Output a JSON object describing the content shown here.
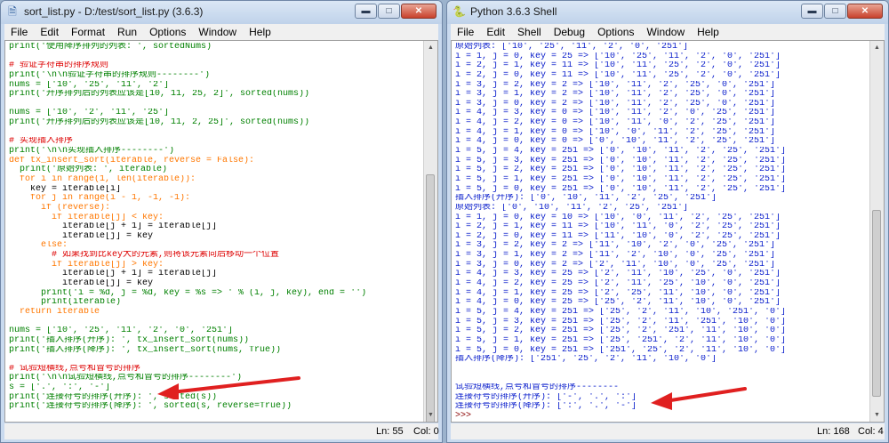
{
  "editor": {
    "title": "sort_list.py - D:/test/sort_list.py (3.6.3)",
    "menu": [
      "File",
      "Edit",
      "Format",
      "Run",
      "Options",
      "Window",
      "Help"
    ],
    "lines": [
      {
        "t": "print('使用降序排列的列表: ', sortedNums)",
        "c": "#008000"
      },
      {
        "t": "",
        "c": "#000000"
      },
      {
        "t": "# 验证字符串的排序规则",
        "c": "#dd0000"
      },
      {
        "t": "print('\\n\\n验证字符串的排序规则--------')",
        "c": "#008000"
      },
      {
        "t": "nums = ['10', '25', '11', '2']",
        "c": "#008000"
      },
      {
        "t": "print('升序排列后的列表应该是[10, 11, 25, 2]', sorted(nums))",
        "c": "#008000"
      },
      {
        "t": "",
        "c": "#000000"
      },
      {
        "t": "nums = ['10', '2', '11', '25']",
        "c": "#008000"
      },
      {
        "t": "print('升序排列后的列表应该是[10, 11, 2, 25]', sorted(nums))",
        "c": "#008000"
      },
      {
        "t": "",
        "c": "#000000"
      },
      {
        "t": "# 实现插入排序",
        "c": "#dd0000"
      },
      {
        "t": "print('\\n\\n实现插入排序--------')",
        "c": "#008000"
      },
      {
        "t": "def tx_insert_sort(iterable, reverse = False):",
        "c": "#ff7700"
      },
      {
        "t": "  print('原始列表: ', iterable)",
        "c": "#008000"
      },
      {
        "t": "  for i in range(1, len(iterable)):",
        "c": "#ff7700"
      },
      {
        "t": "    key = iterable[i]",
        "c": "#000000"
      },
      {
        "t": "    for j in range(i - 1, -1, -1):",
        "c": "#ff7700"
      },
      {
        "t": "      if (reverse):",
        "c": "#ff7700"
      },
      {
        "t": "        if iterable[j] < key:",
        "c": "#ff7700"
      },
      {
        "t": "          iterable[j + 1] = iterable[j]",
        "c": "#000000"
      },
      {
        "t": "          iterable[j] = key",
        "c": "#000000"
      },
      {
        "t": "      else:",
        "c": "#ff7700"
      },
      {
        "t": "        # 如果找到比key大的元素,则将该元素向后移动一个位置",
        "c": "#dd0000"
      },
      {
        "t": "        if iterable[j] > key:",
        "c": "#ff7700"
      },
      {
        "t": "          iterable[j + 1] = iterable[j]",
        "c": "#000000"
      },
      {
        "t": "          iterable[j] = key",
        "c": "#000000"
      },
      {
        "t": "      print('i = %d, j = %d, key = %s => ' % (i, j, key), end = '')",
        "c": "#008000"
      },
      {
        "t": "      print(iterable)",
        "c": "#008000"
      },
      {
        "t": "  return iterable",
        "c": "#ff7700"
      },
      {
        "t": "",
        "c": "#000000"
      },
      {
        "t": "nums = ['10', '25', '11', '2', '0', '251']",
        "c": "#008000"
      },
      {
        "t": "print('插入排序(升序): ', tx_insert_sort(nums))",
        "c": "#008000"
      },
      {
        "t": "print('插入排序(降序): ', tx_insert_sort(nums, True))",
        "c": "#008000"
      },
      {
        "t": "",
        "c": "#000000"
      },
      {
        "t": "# 试验短横线,点号和冒号的排序",
        "c": "#dd0000"
      },
      {
        "t": "print('\\n\\n试验短横线,点号和冒号的排序--------')",
        "c": "#008000"
      },
      {
        "t": "s = ['.', ':', '-']",
        "c": "#008000"
      },
      {
        "t": "print('连接符号的排序(升序): ', sorted(s))",
        "c": "#008000"
      },
      {
        "t": "print('连接符号的排序(降序): ', sorted(s, reverse=True))",
        "c": "#008000"
      }
    ],
    "status": {
      "ln": "Ln: 55",
      "col": "Col: 0"
    }
  },
  "shell": {
    "title": "Python 3.6.3 Shell",
    "menu": [
      "File",
      "Edit",
      "Shell",
      "Debug",
      "Options",
      "Window",
      "Help"
    ],
    "lines": [
      {
        "t": "原始列表: ['10', '25', '11', '2', '0', '251']",
        "c": "#0b1fcc"
      },
      {
        "t": "i = 1, j = 0, key = 25 => ['10', '25', '11', '2', '0', '251']",
        "c": "#0b1fcc"
      },
      {
        "t": "i = 2, j = 1, key = 11 => ['10', '11', '25', '2', '0', '251']",
        "c": "#0b1fcc"
      },
      {
        "t": "i = 2, j = 0, key = 11 => ['10', '11', '25', '2', '0', '251']",
        "c": "#0b1fcc"
      },
      {
        "t": "i = 3, j = 2, key = 2 => ['10', '11', '2', '25', '0', '251']",
        "c": "#0b1fcc"
      },
      {
        "t": "i = 3, j = 1, key = 2 => ['10', '11', '2', '25', '0', '251']",
        "c": "#0b1fcc"
      },
      {
        "t": "i = 3, j = 0, key = 2 => ['10', '11', '2', '25', '0', '251']",
        "c": "#0b1fcc"
      },
      {
        "t": "i = 4, j = 3, key = 0 => ['10', '11', '2', '0', '25', '251']",
        "c": "#0b1fcc"
      },
      {
        "t": "i = 4, j = 2, key = 0 => ['10', '11', '0', '2', '25', '251']",
        "c": "#0b1fcc"
      },
      {
        "t": "i = 4, j = 1, key = 0 => ['10', '0', '11', '2', '25', '251']",
        "c": "#0b1fcc"
      },
      {
        "t": "i = 4, j = 0, key = 0 => ['0', '10', '11', '2', '25', '251']",
        "c": "#0b1fcc"
      },
      {
        "t": "i = 5, j = 4, key = 251 => ['0', '10', '11', '2', '25', '251']",
        "c": "#0b1fcc"
      },
      {
        "t": "i = 5, j = 3, key = 251 => ['0', '10', '11', '2', '25', '251']",
        "c": "#0b1fcc"
      },
      {
        "t": "i = 5, j = 2, key = 251 => ['0', '10', '11', '2', '25', '251']",
        "c": "#0b1fcc"
      },
      {
        "t": "i = 5, j = 1, key = 251 => ['0', '10', '11', '2', '25', '251']",
        "c": "#0b1fcc"
      },
      {
        "t": "i = 5, j = 0, key = 251 => ['0', '10', '11', '2', '25', '251']",
        "c": "#0b1fcc"
      },
      {
        "t": "插入排序(升序): ['0', '10', '11', '2', '25', '251']",
        "c": "#0b1fcc"
      },
      {
        "t": "原始列表: ['0', '10', '11', '2', '25', '251']",
        "c": "#0b1fcc"
      },
      {
        "t": "i = 1, j = 0, key = 10 => ['10', '0', '11', '2', '25', '251']",
        "c": "#0b1fcc"
      },
      {
        "t": "i = 2, j = 1, key = 11 => ['10', '11', '0', '2', '25', '251']",
        "c": "#0b1fcc"
      },
      {
        "t": "i = 2, j = 0, key = 11 => ['11', '10', '0', '2', '25', '251']",
        "c": "#0b1fcc"
      },
      {
        "t": "i = 3, j = 2, key = 2 => ['11', '10', '2', '0', '25', '251']",
        "c": "#0b1fcc"
      },
      {
        "t": "i = 3, j = 1, key = 2 => ['11', '2', '10', '0', '25', '251']",
        "c": "#0b1fcc"
      },
      {
        "t": "i = 3, j = 0, key = 2 => ['2', '11', '10', '0', '25', '251']",
        "c": "#0b1fcc"
      },
      {
        "t": "i = 4, j = 3, key = 25 => ['2', '11', '10', '25', '0', '251']",
        "c": "#0b1fcc"
      },
      {
        "t": "i = 4, j = 2, key = 25 => ['2', '11', '25', '10', '0', '251']",
        "c": "#0b1fcc"
      },
      {
        "t": "i = 4, j = 1, key = 25 => ['2', '25', '11', '10', '0', '251']",
        "c": "#0b1fcc"
      },
      {
        "t": "i = 4, j = 0, key = 25 => ['25', '2', '11', '10', '0', '251']",
        "c": "#0b1fcc"
      },
      {
        "t": "i = 5, j = 4, key = 251 => ['25', '2', '11', '10', '251', '0']",
        "c": "#0b1fcc"
      },
      {
        "t": "i = 5, j = 3, key = 251 => ['25', '2', '11', '251', '10', '0']",
        "c": "#0b1fcc"
      },
      {
        "t": "i = 5, j = 2, key = 251 => ['25', '2', '251', '11', '10', '0']",
        "c": "#0b1fcc"
      },
      {
        "t": "i = 5, j = 1, key = 251 => ['25', '251', '2', '11', '10', '0']",
        "c": "#0b1fcc"
      },
      {
        "t": "i = 5, j = 0, key = 251 => ['251', '25', '2', '11', '10', '0']",
        "c": "#0b1fcc"
      },
      {
        "t": "插入排序(降序): ['251', '25', '2', '11', '10', '0']",
        "c": "#0b1fcc"
      },
      {
        "t": "",
        "c": "#0b1fcc"
      },
      {
        "t": "",
        "c": "#0b1fcc"
      },
      {
        "t": "试验短横线,点号和冒号的排序--------",
        "c": "#0b1fcc"
      },
      {
        "t": "连接符号的排序(升序): ['-', '.', ':']",
        "c": "#0b1fcc"
      },
      {
        "t": "连接符号的排序(降序): [':', '.', '-']",
        "c": "#0b1fcc"
      },
      {
        "t": ">>> ",
        "c": "#8b0000"
      }
    ],
    "status": {
      "ln": "Ln: 168",
      "col": "Col: 4"
    }
  },
  "window_buttons": {
    "minimize": "▬",
    "maximize": "□",
    "close": "✕"
  },
  "colors": {
    "arrow": "#e02020",
    "shell_output": "#0b1fcc",
    "keyword": "#ff7700",
    "string": "#008000",
    "comment": "#dd0000"
  }
}
